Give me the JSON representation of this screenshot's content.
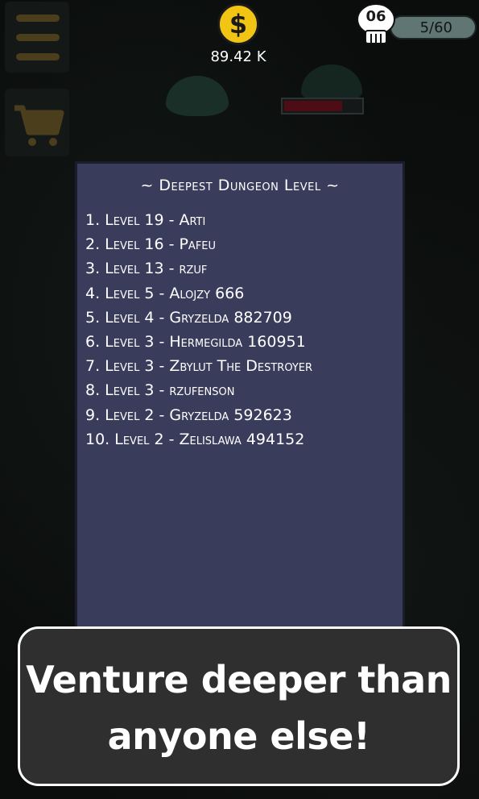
{
  "hud": {
    "coin_symbol": "$",
    "coin_amount": "89.42 K",
    "skull_level": "06",
    "kills": "5/60"
  },
  "enemy": {
    "health_fraction": 0.76
  },
  "leaderboard": {
    "title": "~ Deepest Dungeon Level ~",
    "entries": [
      "1. Level 19 - Arti",
      "2. Level 16 - Pafeu",
      "3. Level 13 - rzuf",
      "4. Level 5 - Alojzy 666",
      "5. Level 4 - Gryzelda 882709",
      "6. Level 3 - Hermegilda 160951",
      "7. Level 3 - Zbylut The Destroyer",
      "8. Level 3 - rzufenson",
      "9. Level 2 - Gryzelda 592623",
      "10. Level 2 - Zelislawa 494152"
    ]
  },
  "banner": {
    "line1": "Venture deeper than",
    "line2": "anyone else!"
  },
  "icons": {
    "menu": "hamburger-menu-icon",
    "shop": "shopping-cart-icon",
    "coin": "dollar-coin-icon",
    "skull": "skull-icon"
  },
  "colors": {
    "coin": "#f2c413",
    "panel": "#3a3c5c",
    "banner": "#2f2f30",
    "health": "#4e0d14"
  }
}
